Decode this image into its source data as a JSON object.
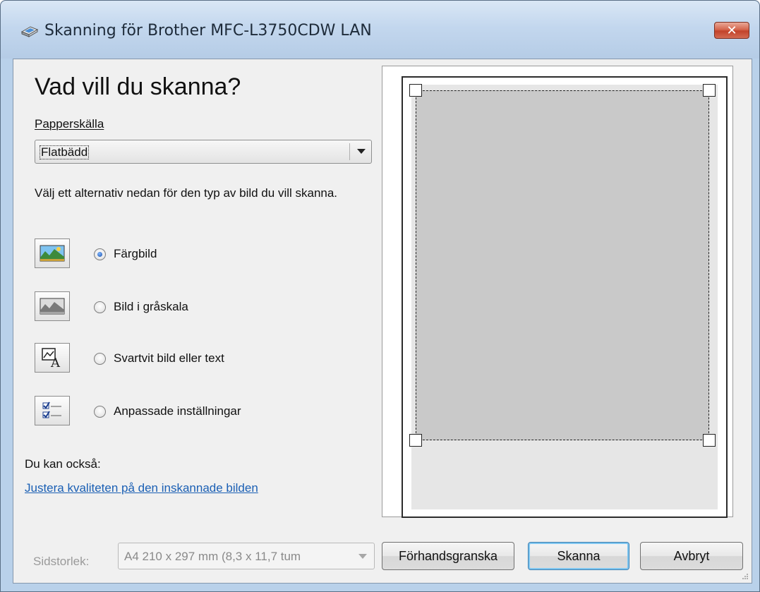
{
  "window": {
    "title": "Skanning för Brother MFC-L3750CDW LAN",
    "close_symbol": "✕"
  },
  "main": {
    "heading": "Vad vill du skanna?",
    "paper_source_label": "Papperskälla",
    "paper_source_value": "Flatbädd",
    "instruction": "Välj ett alternativ nedan för den typ av bild du vill skanna.",
    "options": [
      {
        "label": "Färgbild",
        "icon": "color-picture-icon",
        "selected": true
      },
      {
        "label": "Bild i gråskala",
        "icon": "grayscale-picture-icon",
        "selected": false
      },
      {
        "label": "Svartvit bild eller text",
        "icon": "black-white-text-icon",
        "selected": false
      },
      {
        "label": "Anpassade inställningar",
        "icon": "custom-settings-icon",
        "selected": false
      }
    ],
    "also_label": "Du kan också:",
    "adjust_link": "Justera kvaliteten på den inskannade bilden"
  },
  "footer": {
    "page_size_label": "Sidstorlek:",
    "page_size_value": "A4 210 x 297 mm (8,3 x 11,7 tum",
    "preview_button": "Förhandsgranska",
    "scan_button": "Skanna",
    "cancel_button": "Avbryt"
  }
}
